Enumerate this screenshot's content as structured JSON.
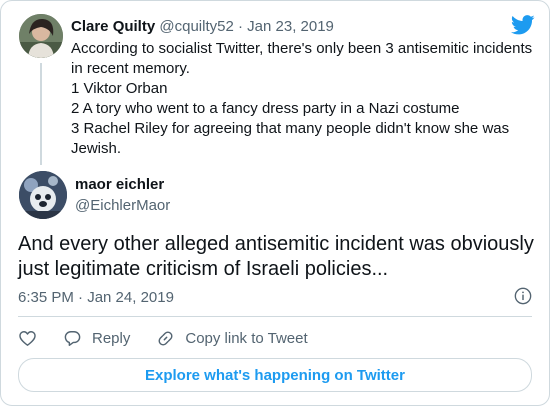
{
  "quoted_tweet": {
    "author_name": "Clare Quilty",
    "author_handle": "@cquilty52",
    "separator": "·",
    "date": "Jan 23, 2019",
    "lines": [
      "According to socialist Twitter, there's only been 3 antisemitic incidents",
      "in recent memory.",
      "1 Viktor Orban",
      "2 A tory who went to a fancy dress party in a Nazi costume",
      "3 Rachel Riley for agreeing that many people didn't know she was",
      "Jewish."
    ]
  },
  "main_tweet": {
    "author_name": "maor eichler",
    "author_handle": "@EichlerMaor",
    "lines": [
      "And every other alleged antisemitic incident was obviously",
      "just legitimate criticism of Israeli policies..."
    ],
    "timestamp": "6:35 PM · Jan 24, 2019"
  },
  "actions": {
    "reply_label": "Reply",
    "copy_link_label": "Copy link to Tweet"
  },
  "explore_label": "Explore what's happening on Twitter",
  "colors": {
    "twitter_blue": "#1d9bf0",
    "secondary_text": "#536471",
    "border": "#cfd9de"
  },
  "icons": [
    "twitter-bird-icon",
    "info-icon",
    "heart-icon",
    "reply-icon",
    "link-icon"
  ]
}
